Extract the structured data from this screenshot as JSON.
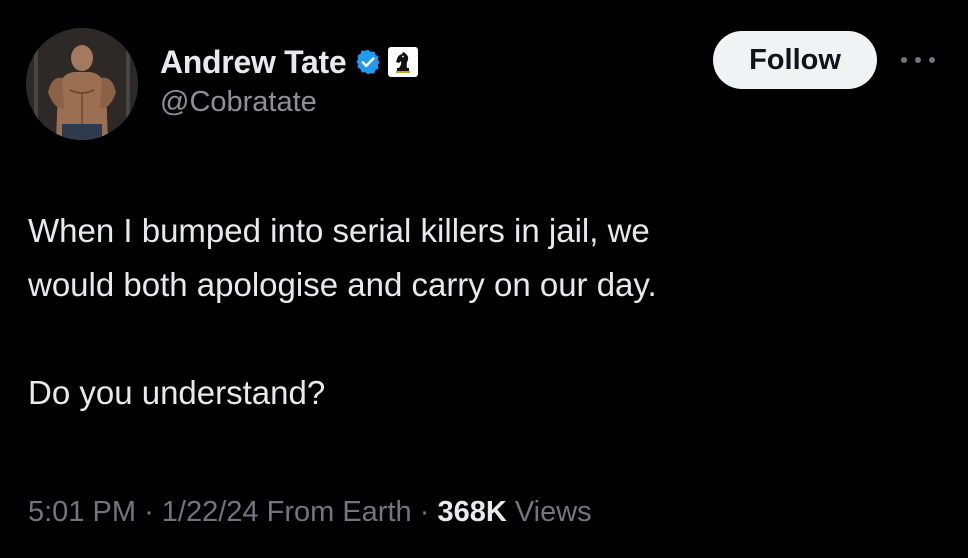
{
  "user": {
    "display_name": "Andrew Tate",
    "handle": "@Cobratate",
    "verified_color": "#1d9bf0",
    "badges": [
      "verified-icon",
      "chess-knight-icon"
    ]
  },
  "actions": {
    "follow_label": "Follow",
    "more_icon": "more-icon"
  },
  "tweet": {
    "lines": [
      "When I bumped into serial killers in jail, we",
      "would both apologise and carry on our day."
    ],
    "closing": "Do you understand?"
  },
  "meta": {
    "time": "5:01 PM",
    "date": "1/22/24",
    "location": "From Earth",
    "views_count": "368K",
    "views_label": "Views",
    "separator": "·"
  }
}
